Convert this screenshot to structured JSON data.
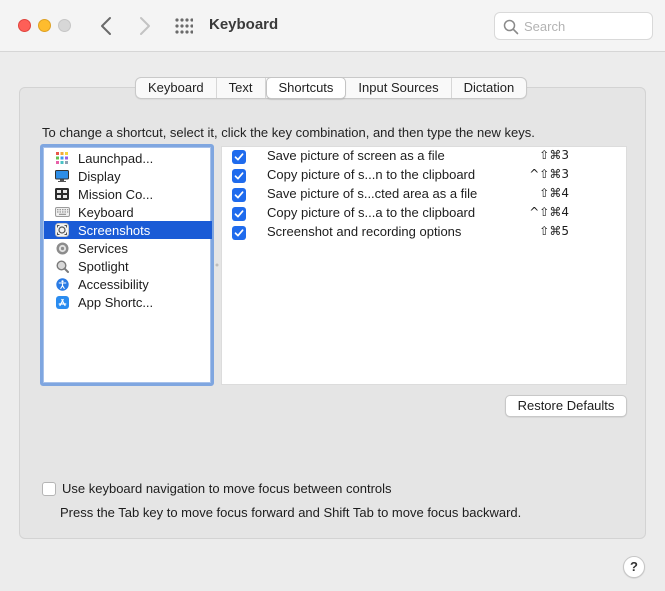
{
  "window": {
    "title": "Keyboard",
    "search_placeholder": "Search"
  },
  "tabs": [
    {
      "label": "Keyboard",
      "active": false
    },
    {
      "label": "Text",
      "active": false
    },
    {
      "label": "Shortcuts",
      "active": true
    },
    {
      "label": "Input Sources",
      "active": false
    },
    {
      "label": "Dictation",
      "active": false
    }
  ],
  "instruction": "To change a shortcut, select it, click the key combination, and then type the new keys.",
  "categories": [
    {
      "label": "Launchpad...",
      "icon": "launchpad-icon",
      "selected": false
    },
    {
      "label": "Display",
      "icon": "display-icon",
      "selected": false
    },
    {
      "label": "Mission Co...",
      "icon": "mission-control-icon",
      "selected": false
    },
    {
      "label": "Keyboard",
      "icon": "keyboard-icon",
      "selected": false
    },
    {
      "label": "Screenshots",
      "icon": "screenshot-icon",
      "selected": true
    },
    {
      "label": "Services",
      "icon": "gear-icon",
      "selected": false
    },
    {
      "label": "Spotlight",
      "icon": "spotlight-icon",
      "selected": false
    },
    {
      "label": "Accessibility",
      "icon": "accessibility-icon",
      "selected": false
    },
    {
      "label": "App Shortc...",
      "icon": "app-store-icon",
      "selected": false
    }
  ],
  "shortcuts": [
    {
      "checked": true,
      "label": "Save picture of screen as a file",
      "keys": "⇧⌘3"
    },
    {
      "checked": true,
      "label": "Copy picture of s...n to the clipboard",
      "keys": "^⇧⌘3"
    },
    {
      "checked": true,
      "label": "Save picture of s...cted area as a file",
      "keys": "⇧⌘4"
    },
    {
      "checked": true,
      "label": "Copy picture of s...a to the clipboard",
      "keys": "^⇧⌘4"
    },
    {
      "checked": true,
      "label": "Screenshot and recording options",
      "keys": "⇧⌘5"
    }
  ],
  "restore_defaults_label": "Restore Defaults",
  "keyboard_navigation": {
    "checked": false,
    "label": "Use keyboard navigation to move focus between controls",
    "hint": "Press the Tab key to move focus forward and Shift Tab to move focus backward."
  },
  "help_label": "?",
  "colors": {
    "accent": "#1a5bd6",
    "checkbox": "#1f6bed",
    "close": "#fe5f57",
    "minimize": "#febc2e"
  }
}
